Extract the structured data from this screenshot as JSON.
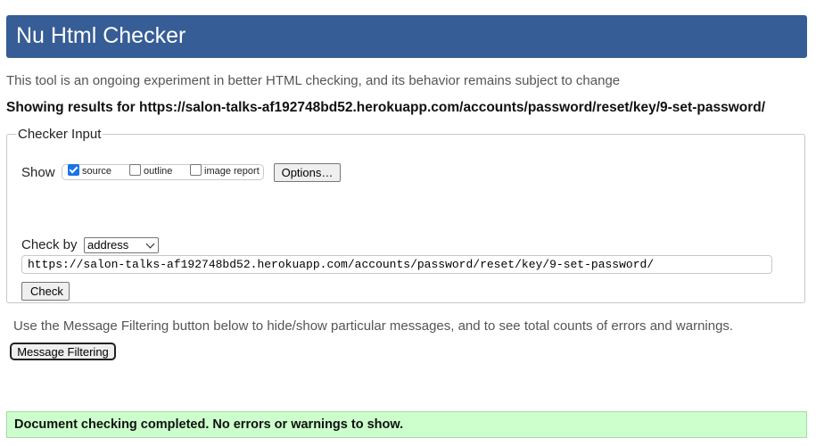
{
  "header": {
    "title": "Nu Html Checker",
    "bg_color": "#365d95"
  },
  "intro": "This tool is an ongoing experiment in better HTML checking, and its behavior remains subject to change",
  "showing": "Showing results for https://salon-talks-af192748bd52.herokuapp.com/accounts/password/reset/key/9-set-password/",
  "checker_input": {
    "legend": "Checker Input",
    "show_label": "Show",
    "show_options": [
      {
        "label": "source",
        "checked": true
      },
      {
        "label": "outline",
        "checked": false
      },
      {
        "label": "image report",
        "checked": false
      }
    ],
    "options_button": "Options…",
    "check_by_label": "Check by",
    "check_by_value": "address",
    "url_value": "https://salon-talks-af192748bd52.herokuapp.com/accounts/password/reset/key/9-set-password/",
    "check_button": "Check"
  },
  "filter_note": "Use the Message Filtering button below to hide/show particular messages, and to see total counts of errors and warnings.",
  "filter_button": "Message Filtering",
  "result": {
    "message": "Document checking completed. No errors or warnings to show.",
    "bg_color": "#ccffcc"
  }
}
